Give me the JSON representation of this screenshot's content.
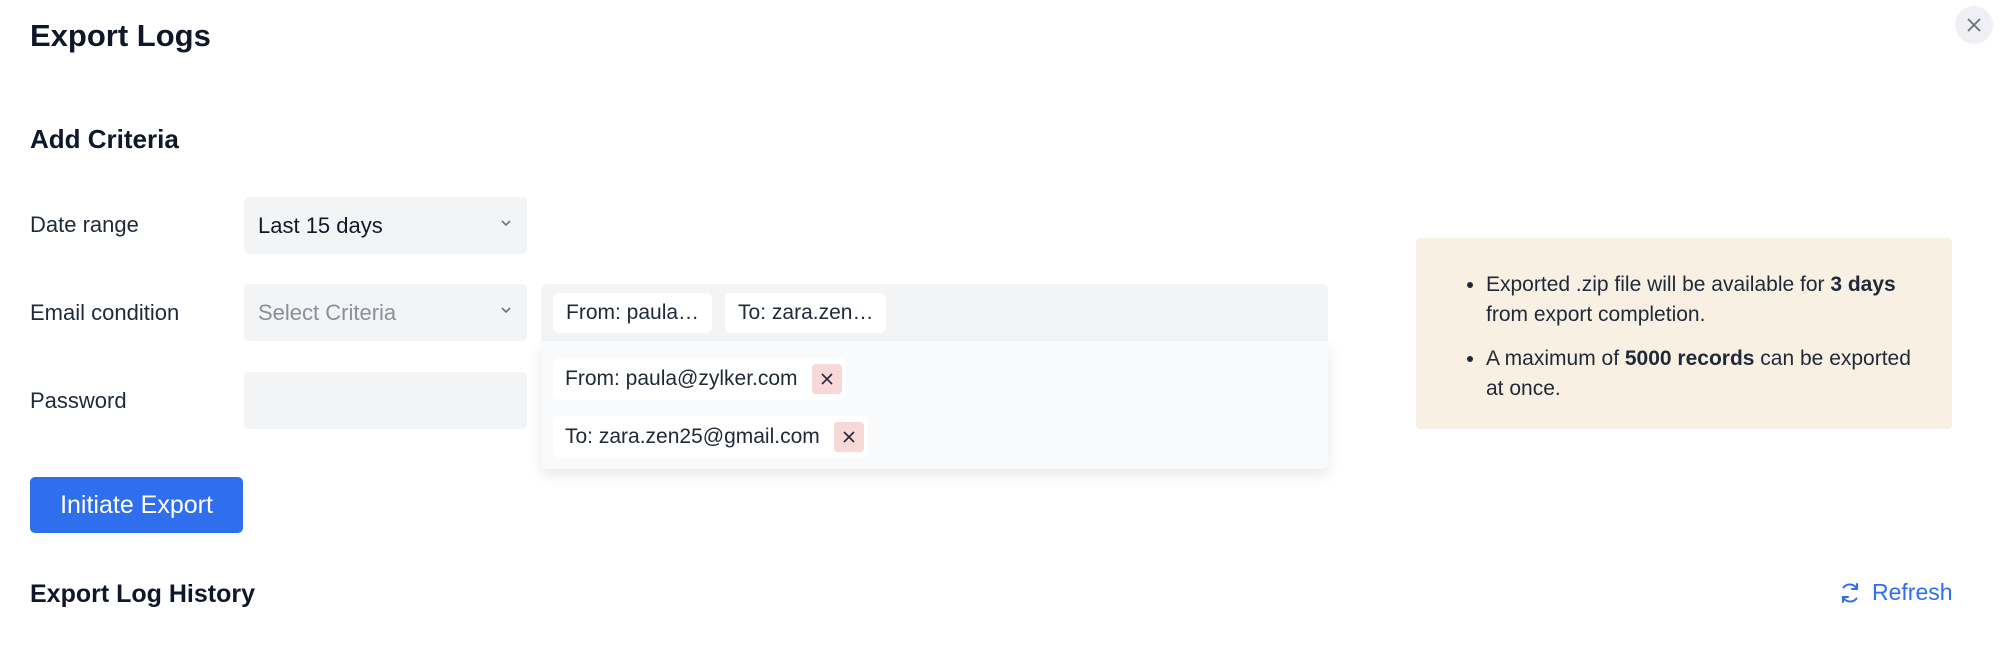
{
  "header": {
    "title": "Export Logs"
  },
  "criteria": {
    "section_title": "Add Criteria",
    "date_range": {
      "label": "Date range",
      "value": "Last 15 days"
    },
    "email_condition": {
      "label": "Email condition",
      "placeholder": "Select Criteria",
      "chips": [
        "From: paula…",
        "To: zara.zen…"
      ],
      "dropdown_items": [
        "From: paula@zylker.com",
        "To: zara.zen25@gmail.com"
      ]
    },
    "password": {
      "label": "Password",
      "value": ""
    }
  },
  "actions": {
    "initiate_export": "Initiate Export"
  },
  "info": {
    "item1_pre": "Exported .zip file will be available for ",
    "item1_bold": "3 days",
    "item1_post": " from export completion.",
    "item2_pre": "A maximum of ",
    "item2_bold": "5000 records",
    "item2_post": " can be exported at once."
  },
  "history": {
    "title": "Export Log History",
    "refresh_label": "Refresh"
  },
  "colors": {
    "accent": "#2f6fed",
    "info_bg": "#f8f0e3",
    "remove_bg": "#f8d7d7"
  },
  "icons": {
    "close": "close-icon",
    "chevron": "chevron-down-icon",
    "refresh": "refresh-icon",
    "remove": "remove-icon"
  }
}
